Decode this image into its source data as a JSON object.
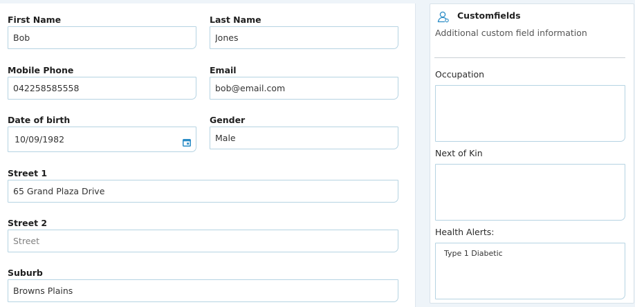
{
  "form": {
    "first_name": {
      "label": "First Name",
      "value": "Bob"
    },
    "last_name": {
      "label": "Last Name",
      "value": "Jones"
    },
    "mobile_phone": {
      "label": "Mobile Phone",
      "value": "042258585558"
    },
    "email": {
      "label": "Email",
      "value": "bob@email.com"
    },
    "date_of_birth": {
      "label": "Date of birth",
      "value": "10/09/1982",
      "icon": "calendar-icon"
    },
    "gender": {
      "label": "Gender",
      "value": "Male"
    },
    "street1": {
      "label": "Street 1",
      "value": "65 Grand Plaza Drive"
    },
    "street2": {
      "label": "Street 2",
      "value": "",
      "placeholder": "Street"
    },
    "suburb": {
      "label": "Suburb",
      "value": "Browns Plains"
    }
  },
  "customfields": {
    "icon": "user-icon",
    "title": "Customfields",
    "subtitle": "Additional custom field information",
    "occupation": {
      "label": "Occupation",
      "value": ""
    },
    "next_of_kin": {
      "label": "Next of Kin",
      "value": ""
    },
    "health_alerts": {
      "label": "Health Alerts:",
      "value": "Type 1 Diabetic"
    }
  },
  "colors": {
    "input_border": "#b5d3e2",
    "accent": "#2a8cc6"
  }
}
